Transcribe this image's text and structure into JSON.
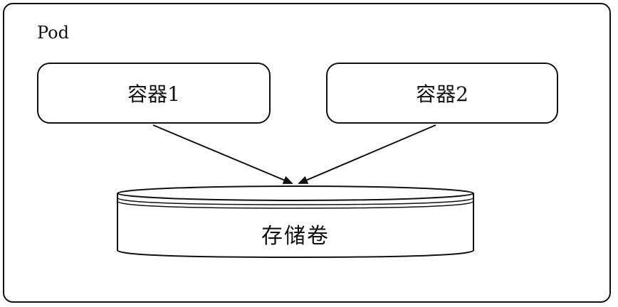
{
  "diagram": {
    "pod_label": "Pod",
    "containers": [
      {
        "label": "容器1"
      },
      {
        "label": "容器2"
      }
    ],
    "volume_label": "存储卷"
  }
}
